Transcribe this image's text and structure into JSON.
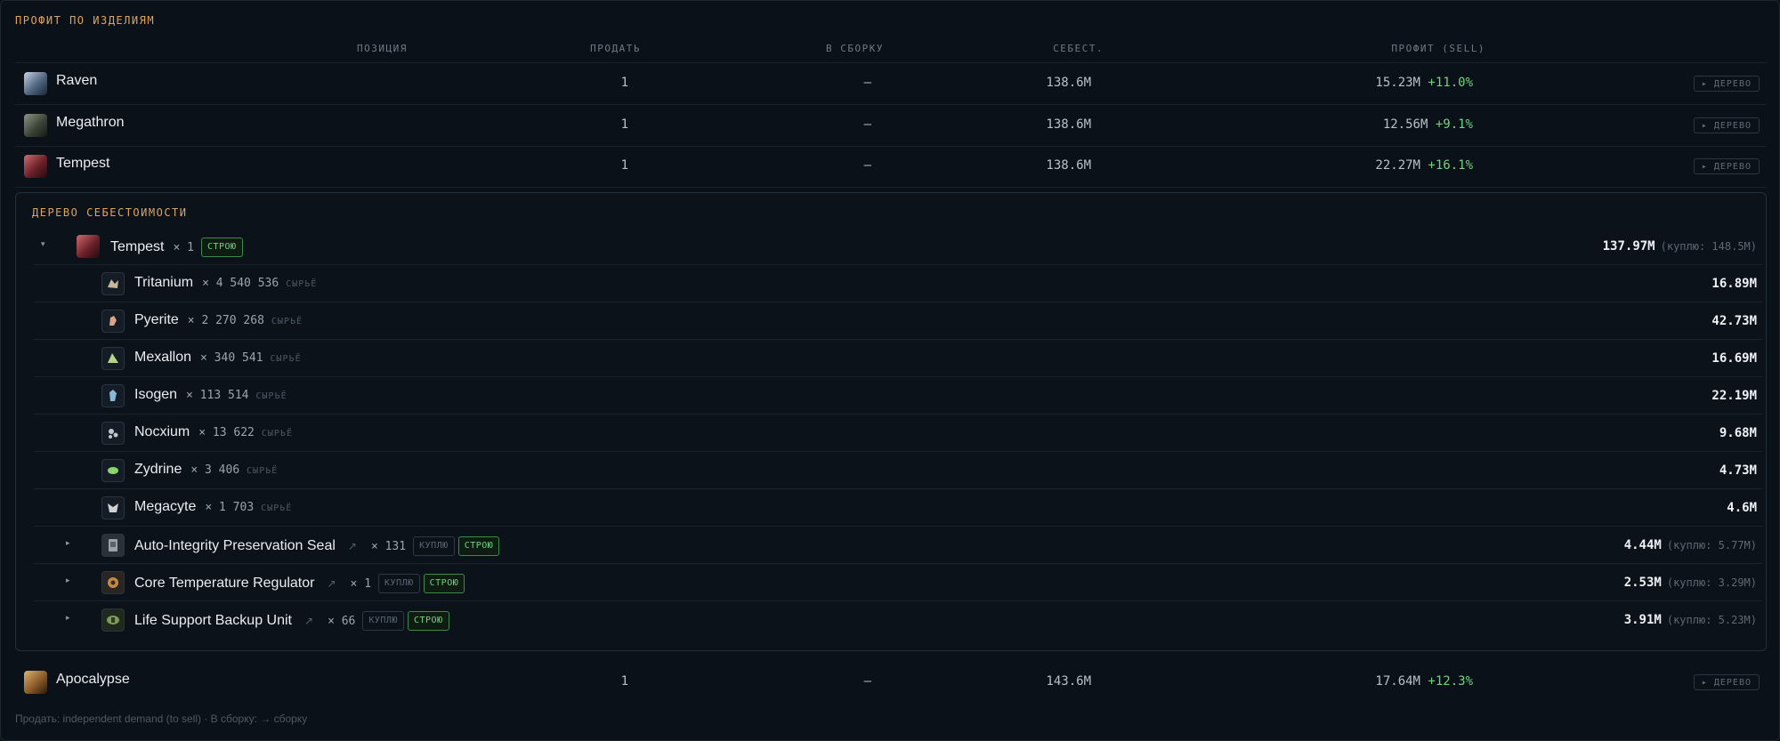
{
  "section_title": "ПРОФИТ ПО ИЗДЕЛИЯМ",
  "columns": {
    "position": "ПОЗИЦИЯ",
    "sell": "ПРОДАТЬ",
    "build": "В СБОРКУ",
    "cost": "СЕБЕСТ.",
    "profit": "ПРОФИТ (SELL)"
  },
  "tree_button_label": "▸ ДЕРЕВО",
  "items": [
    {
      "name": "Raven",
      "sell": "1",
      "build": "—",
      "cost": "138.6M",
      "profit": "15.23M",
      "pct": "+11.0%",
      "color": "#7f98b8"
    },
    {
      "name": "Megathron",
      "sell": "1",
      "build": "—",
      "cost": "138.6M",
      "profit": "12.56M",
      "pct": "+9.1%",
      "color": "#6a7466"
    },
    {
      "name": "Tempest",
      "sell": "1",
      "build": "—",
      "cost": "138.6M",
      "profit": "22.27M",
      "pct": "+16.1%",
      "color": "#8a3038"
    }
  ],
  "last_item": {
    "name": "Apocalypse",
    "sell": "1",
    "build": "—",
    "cost": "143.6M",
    "profit": "17.64M",
    "pct": "+12.3%",
    "color": "#9a6a3a"
  },
  "tree": {
    "title": "ДЕРЕВО СЕБЕСТОИМОСТИ",
    "root": {
      "caret": "▾",
      "name": "Tempest",
      "qty": "× 1",
      "badge_build": "СТРОЮ",
      "value": "137.97M",
      "buy": "(куплю: 148.5M)"
    },
    "raw_label": "СЫРЬЁ",
    "materials": [
      {
        "name": "Tritanium",
        "qty": "× 4 540 536",
        "value": "16.89M",
        "color": "#c8b89a"
      },
      {
        "name": "Pyerite",
        "qty": "× 2 270 268",
        "value": "42.73M",
        "color": "#d9a48a"
      },
      {
        "name": "Mexallon",
        "qty": "× 340 541",
        "value": "16.69M",
        "color": "#b8d48a"
      },
      {
        "name": "Isogen",
        "qty": "× 113 514",
        "value": "22.19M",
        "color": "#8ab8d9"
      },
      {
        "name": "Nocxium",
        "qty": "× 13 622",
        "value": "9.68M",
        "color": "#c0c4cc"
      },
      {
        "name": "Zydrine",
        "qty": "× 3 406",
        "value": "4.73M",
        "color": "#8ad46a"
      },
      {
        "name": "Megacyte",
        "qty": "× 1 703",
        "value": "4.6M",
        "color": "#d0d0d0"
      }
    ],
    "components": [
      {
        "caret": "▸",
        "name": "Auto-Integrity Preservation Seal",
        "link": "↗",
        "qty": "× 131",
        "badge_buy": "КУПЛЮ",
        "badge_build": "СТРОЮ",
        "value": "4.44M",
        "buy": "(куплю: 5.77M)",
        "color": "#9aa2a8"
      },
      {
        "caret": "▸",
        "name": "Core Temperature Regulator",
        "link": "↗",
        "qty": "× 1",
        "badge_buy": "КУПЛЮ",
        "badge_build": "СТРОЮ",
        "value": "2.53M",
        "buy": "(куплю: 3.29M)",
        "color": "#c08a4a"
      },
      {
        "caret": "▸",
        "name": "Life Support Backup Unit",
        "link": "↗",
        "qty": "× 66",
        "badge_buy": "КУПЛЮ",
        "badge_build": "СТРОЮ",
        "value": "3.91M",
        "buy": "(куплю: 5.23M)",
        "color": "#7f9a5a"
      }
    ]
  },
  "footer": "Продать: independent demand (to sell) · В сборку: → сборку"
}
